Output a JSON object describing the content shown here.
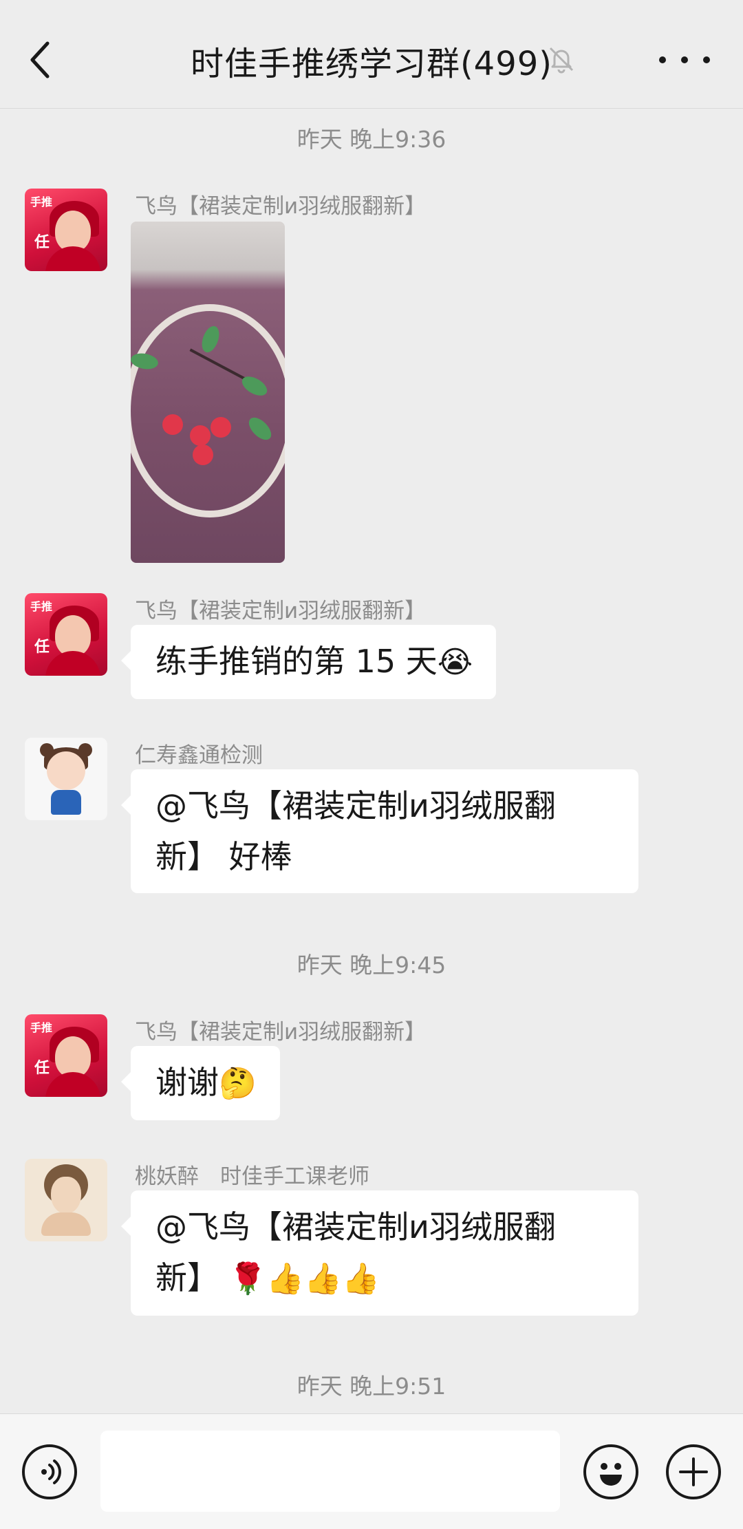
{
  "header": {
    "title": "时佳手推绣学习群(499)",
    "back_icon": "chevron-left-icon",
    "mute_icon": "bell-off-icon",
    "more_icon": "more-horizontal-icon"
  },
  "timestamps": [
    "昨天 晚上9:36",
    "昨天 晚上9:45",
    "昨天 晚上9:51"
  ],
  "messages": [
    {
      "sender": "飞鸟【裙装定制и羽绒服翻新】",
      "type": "image",
      "avatar": "red-avatar"
    },
    {
      "sender": "飞鸟【裙装定制и羽绒服翻新】",
      "type": "text",
      "text": "练手推销的第 15 天",
      "emoji": "😭"
    },
    {
      "sender": "仁寿鑫通检测",
      "type": "text",
      "line1": "@飞鸟【裙装定制и羽绒服翻",
      "line2": "新】 好棒"
    },
    {
      "sender": "飞鸟【裙装定制и羽绒服翻新】",
      "type": "text",
      "text": "谢谢",
      "emoji": "🤔"
    },
    {
      "sender": "桃妖醉　时佳手工课老师",
      "type": "text",
      "line1": "@飞鸟【裙装定制и羽绒服翻",
      "line2": "新】",
      "emoji": "🌹👍👍👍"
    }
  ],
  "avatar_labels": {
    "brand": "手推",
    "ren": "任"
  },
  "input_bar": {
    "voice_icon": "voice-icon",
    "emoji_icon": "emoji-icon",
    "plus_icon": "plus-icon",
    "input_value": ""
  }
}
